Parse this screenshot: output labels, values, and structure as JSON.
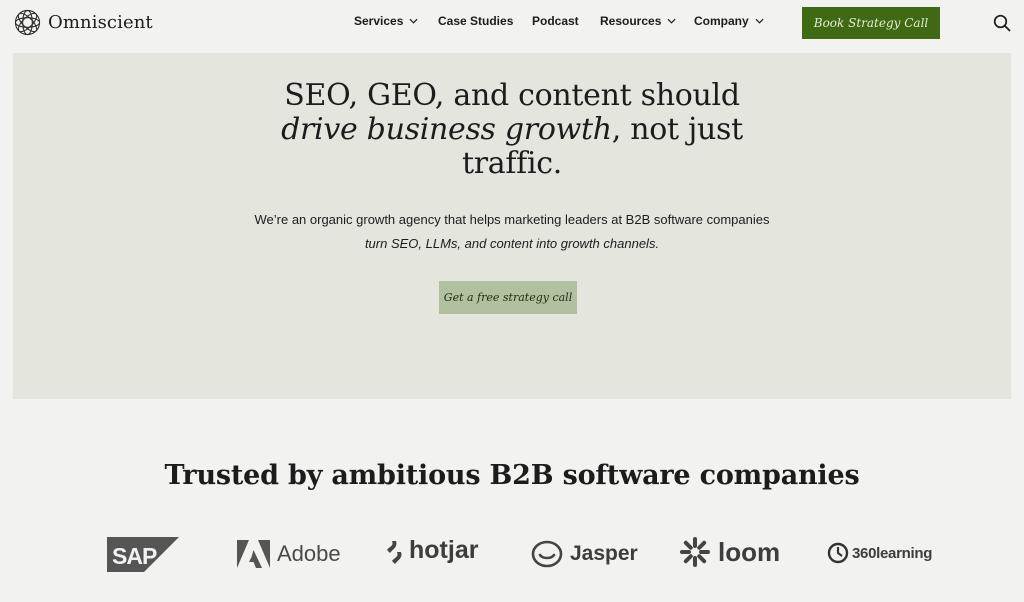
{
  "brand": {
    "name": "Omniscient"
  },
  "nav": {
    "items": [
      {
        "label": "Services",
        "has_dropdown": true
      },
      {
        "label": "Case Studies",
        "has_dropdown": false
      },
      {
        "label": "Podcast",
        "has_dropdown": false
      },
      {
        "label": "Resources",
        "has_dropdown": true
      },
      {
        "label": "Company",
        "has_dropdown": true
      }
    ],
    "cta_label": "Book Strategy Call",
    "search_icon": "search-icon"
  },
  "hero": {
    "title_line1": "SEO, GEO, and content should",
    "title_italic": "drive business growth",
    "title_after_italic": ", not just",
    "title_line3": "traffic.",
    "subtitle": "We’re an organic growth agency that helps marketing leaders at B2B software companies",
    "subtitle_italic": "turn SEO, LLMs, and content into growth channels.",
    "cta_label": "Get a free strategy call"
  },
  "trusted": {
    "heading": "Trusted by ambitious B2B software companies",
    "logos": [
      "SAP",
      "Adobe",
      "hotjar",
      "Jasper",
      "loom",
      "360learning"
    ]
  },
  "colors": {
    "cta_dark_green": "#3f6a13",
    "hero_bg": "#e4e5dd",
    "cta_light_green": "#b3c09f",
    "page_bg": "#f2f2f0"
  }
}
